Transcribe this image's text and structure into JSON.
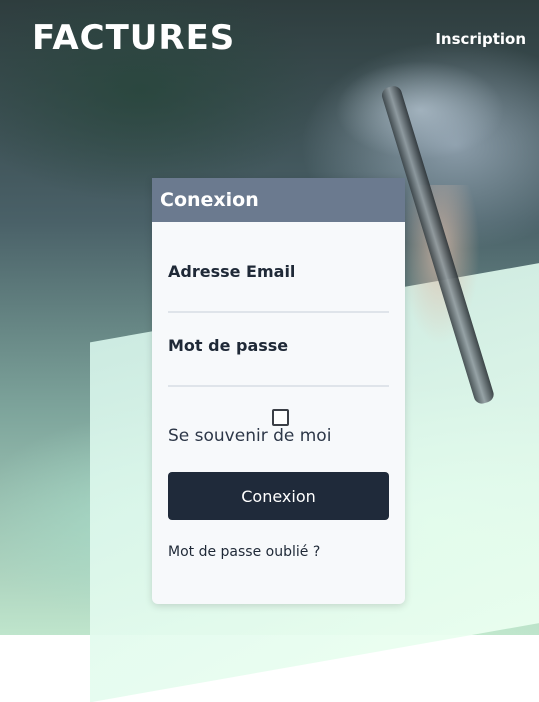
{
  "header": {
    "brand": "FACTURES",
    "signup_link": "Inscription"
  },
  "login_card": {
    "title": "Conexion",
    "email_label": "Adresse Email",
    "email_value": "",
    "password_label": "Mot de passe",
    "password_value": "",
    "remember_label": "Se souvenir de moi",
    "remember_checked": false,
    "submit_label": "Conexion",
    "forgot_link": "Mot de passe oublié ?"
  },
  "colors": {
    "card_header": "#6b7a8f",
    "button": "#1f2a3a",
    "card_background": "#f7f9fb"
  }
}
